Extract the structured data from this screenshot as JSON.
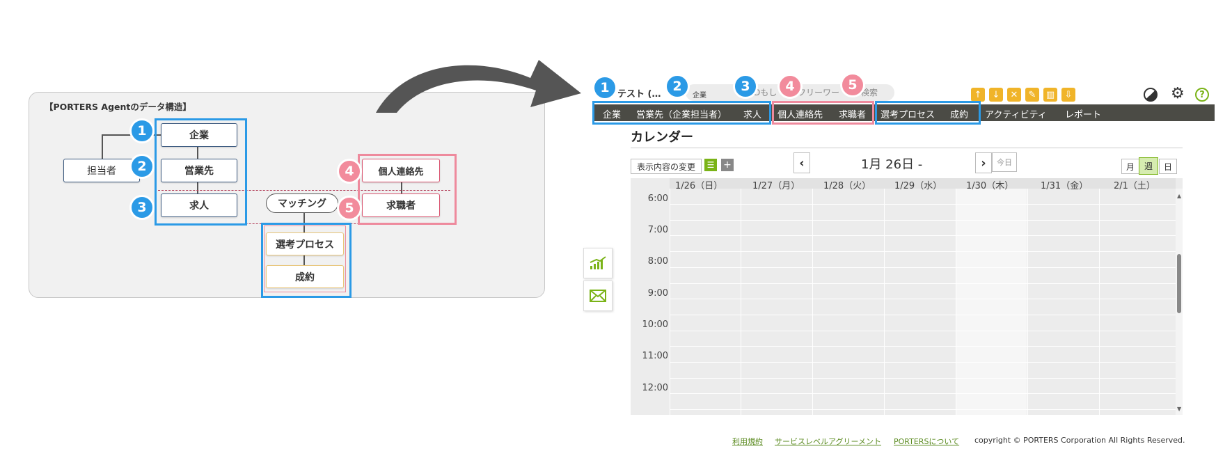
{
  "diagram": {
    "title": "【PORTERS Agentのデータ構造】",
    "nodes": {
      "company": "企業",
      "sales_contact": "営業先",
      "staff": "担当者",
      "job": "求人",
      "matching": "マッチング",
      "personal_contact": "個人連絡先",
      "candidate": "求職者",
      "selection": "選考プロセス",
      "contract": "成約"
    },
    "badges": [
      "1",
      "2",
      "3",
      "4",
      "5"
    ]
  },
  "app": {
    "tabs": [
      "テスト (…",
      "企業",
      "Dもし",
      "フリーワー",
      "検索"
    ],
    "nav": [
      "企業",
      "営業先（企業担当者）",
      "求人",
      "個人連絡先",
      "求職者",
      "選考プロセス",
      "成約",
      "アクティビティ",
      "レポート"
    ],
    "calendar": {
      "title": "カレンダー",
      "change_display": "表示内容の変更",
      "date_label": "1月 26日 -",
      "today": "今日",
      "views": [
        "月",
        "週",
        "日"
      ],
      "days": [
        "1/26（日）",
        "1/27（月）",
        "1/28（火）",
        "1/29（水）",
        "1/30（木）",
        "1/31（金）",
        "2/1（土）"
      ],
      "times": [
        "6:00",
        "7:00",
        "8:00",
        "9:00",
        "10:00",
        "11:00",
        "12:00"
      ]
    },
    "footer": {
      "links": [
        "利用規約",
        "サービスレベルアグリーメント",
        "PORTERSについて"
      ],
      "copyright": "copyright © PORTERS Corporation All Rights Reserved."
    }
  },
  "colors": {
    "blue_accent": "#2b9ae6",
    "pink_accent": "#ee8a9d",
    "nav_bg": "#4b4b45",
    "toolbar_icon": "#f0b429",
    "green_icon": "#7ab317"
  }
}
